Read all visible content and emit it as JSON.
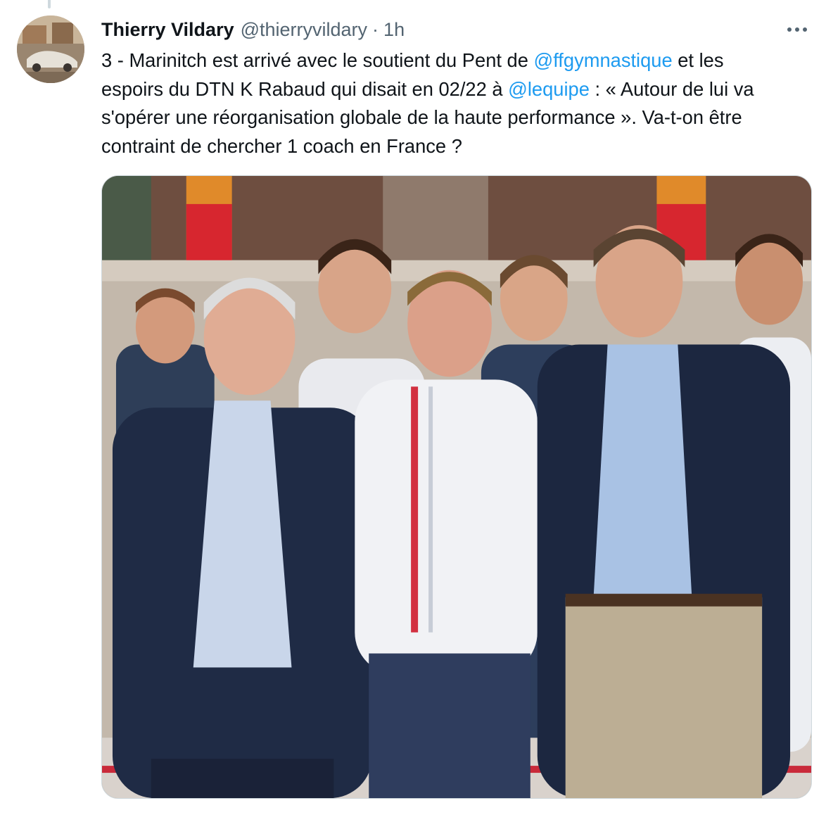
{
  "tweet": {
    "author": {
      "display_name": "Thierry Vildary",
      "handle": "@thierryvildary"
    },
    "separator": "·",
    "time": "1h",
    "text": {
      "line1": {
        "before": "3 - Marinitch est arrivé avec le soutient du Pent de ",
        "mention": "@ffgymnastique",
        "after": " et les"
      },
      "line2": {
        "before": "espoirs du DTN K Rabaud qui disait en 02/22 à ",
        "mention": "@lequipe",
        "after": " : « Autour de lui va"
      },
      "line3": "s'opérer une réorganisation globale de la haute performance ». Va-t-on être",
      "line4": "contraint de chercher 1 coach en France ?"
    },
    "icons": {
      "more": "more-horizontal-icon"
    }
  },
  "colors": {
    "text": "#0f1419",
    "secondary": "#536471",
    "link": "#1d9bf0",
    "border": "#cfd9de"
  }
}
